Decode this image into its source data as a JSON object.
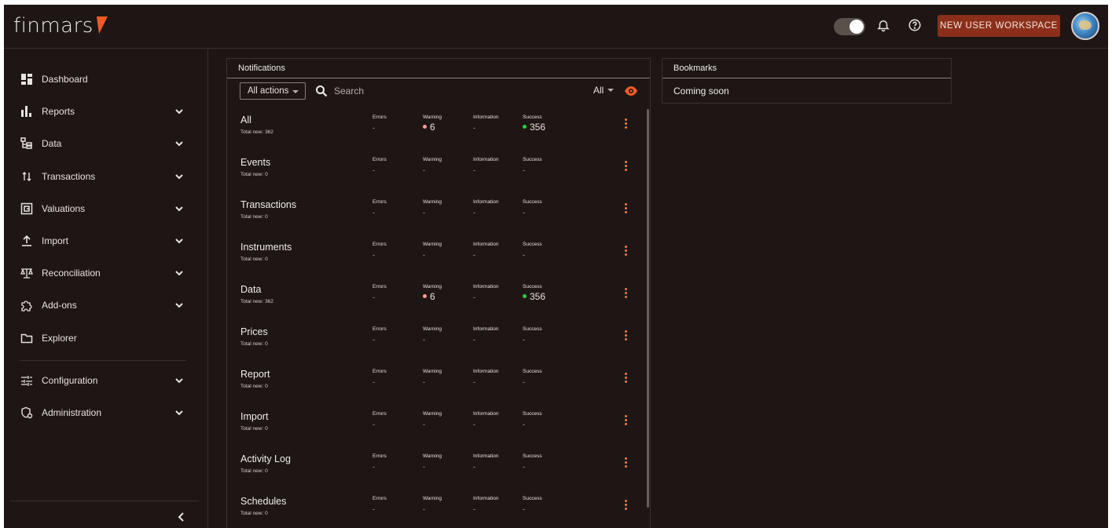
{
  "app": {
    "logo_text": "finmars"
  },
  "header": {
    "workspace_button": "NEW USER WORKSPACE"
  },
  "sidebar": {
    "items": [
      {
        "label": "Dashboard",
        "icon": "dashboard-icon",
        "has_chevron": false
      },
      {
        "label": "Reports",
        "icon": "bar-chart-icon",
        "has_chevron": true
      },
      {
        "label": "Data",
        "icon": "data-tree-icon",
        "has_chevron": true
      },
      {
        "label": "Transactions",
        "icon": "transactions-arrows-icon",
        "has_chevron": true
      },
      {
        "label": "Valuations",
        "icon": "wallet-icon",
        "has_chevron": true
      },
      {
        "label": "Import",
        "icon": "upload-icon",
        "has_chevron": true
      },
      {
        "label": "Reconciliation",
        "icon": "scales-icon",
        "has_chevron": true
      },
      {
        "label": "Add-ons",
        "icon": "puzzle-icon",
        "has_chevron": true
      },
      {
        "label": "Explorer",
        "icon": "folder-icon",
        "has_chevron": false
      },
      {
        "label": "Configuration",
        "icon": "sliders-icon",
        "has_chevron": true
      },
      {
        "label": "Administration",
        "icon": "admin-shield-icon",
        "has_chevron": true
      }
    ]
  },
  "notifications": {
    "title": "Notifications",
    "actions_select": "All actions",
    "search_placeholder": "Search",
    "filter_select": "All",
    "column_labels": {
      "errors": "Errors",
      "warning": "Warning",
      "information": "Information",
      "success": "Success"
    },
    "rows": [
      {
        "title": "All",
        "total": "Total new: 362",
        "errors": "-",
        "warning": "6",
        "information": "-",
        "success": "356"
      },
      {
        "title": "Events",
        "total": "Total new: 0",
        "errors": "-",
        "warning": "-",
        "information": "-",
        "success": "-"
      },
      {
        "title": "Transactions",
        "total": "Total new: 0",
        "errors": "-",
        "warning": "-",
        "information": "-",
        "success": "-"
      },
      {
        "title": "Instruments",
        "total": "Total new: 0",
        "errors": "-",
        "warning": "-",
        "information": "-",
        "success": "-"
      },
      {
        "title": "Data",
        "total": "Total new: 362",
        "errors": "-",
        "warning": "6",
        "information": "-",
        "success": "356"
      },
      {
        "title": "Prices",
        "total": "Total new: 0",
        "errors": "-",
        "warning": "-",
        "information": "-",
        "success": "-"
      },
      {
        "title": "Report",
        "total": "Total new: 0",
        "errors": "-",
        "warning": "-",
        "information": "-",
        "success": "-"
      },
      {
        "title": "Import",
        "total": "Total new: 0",
        "errors": "-",
        "warning": "-",
        "information": "-",
        "success": "-"
      },
      {
        "title": "Activity Log",
        "total": "Total new: 0",
        "errors": "-",
        "warning": "-",
        "information": "-",
        "success": "-"
      },
      {
        "title": "Schedules",
        "total": "Total new: 0",
        "errors": "-",
        "warning": "-",
        "information": "-",
        "success": "-"
      }
    ]
  },
  "bookmarks": {
    "title": "Bookmarks",
    "body": "Coming soon"
  },
  "colors": {
    "background": "#1e1614",
    "accent": "#f05a28",
    "workspace_button": "#8b2f1a",
    "warning_dot": "#f0a090",
    "success_dot": "#2ecc40",
    "kebab": "#f07a4a"
  }
}
